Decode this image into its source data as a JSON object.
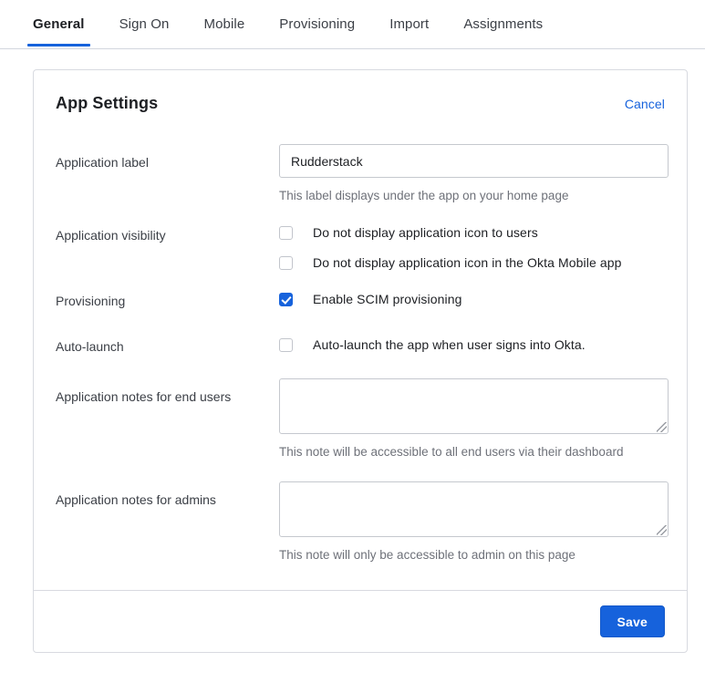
{
  "tabs": [
    {
      "label": "General",
      "active": true
    },
    {
      "label": "Sign On",
      "active": false
    },
    {
      "label": "Mobile",
      "active": false
    },
    {
      "label": "Provisioning",
      "active": false
    },
    {
      "label": "Import",
      "active": false
    },
    {
      "label": "Assignments",
      "active": false
    }
  ],
  "card": {
    "title": "App Settings",
    "cancel_label": "Cancel",
    "save_label": "Save"
  },
  "fields": {
    "application_label": {
      "label": "Application label",
      "value": "Rudderstack",
      "placeholder": "",
      "helper": "This label displays under the app on your home page"
    },
    "application_visibility": {
      "label": "Application visibility",
      "options": [
        {
          "label": "Do not display application icon to users",
          "checked": false
        },
        {
          "label": "Do not display application icon in the Okta Mobile app",
          "checked": false
        }
      ]
    },
    "provisioning": {
      "label": "Provisioning",
      "options": [
        {
          "label": "Enable SCIM provisioning",
          "checked": true
        }
      ]
    },
    "auto_launch": {
      "label": "Auto-launch",
      "options": [
        {
          "label": "Auto-launch the app when user signs into Okta.",
          "checked": false
        }
      ]
    },
    "notes_end_users": {
      "label": "Application notes for end users",
      "value": "",
      "placeholder": "",
      "helper": "This note will be accessible to all end users via their dashboard"
    },
    "notes_admins": {
      "label": "Application notes for admins",
      "value": "",
      "placeholder": "",
      "helper": "This note will only be accessible to admin on this page"
    }
  },
  "colors": {
    "accent": "#1662dc",
    "text": "#1d1f23",
    "muted": "#6e7179",
    "border": "#d8dae0"
  }
}
